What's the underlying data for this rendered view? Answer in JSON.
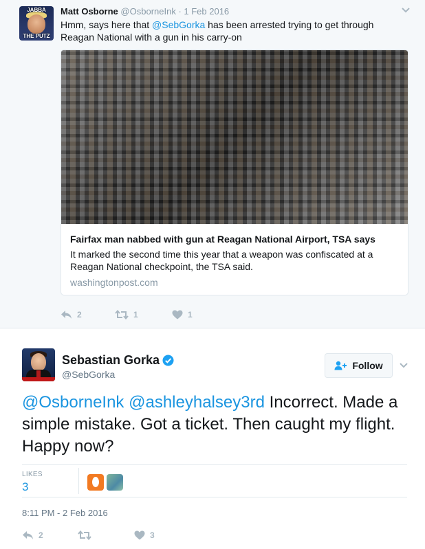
{
  "context_tweet": {
    "avatar_caption_top": "JABBA",
    "avatar_caption_bottom": "THE PUTZ",
    "name": "Matt Osborne",
    "handle": "@OsborneInk",
    "separator": " · ",
    "date": "1 Feb 2016",
    "text_before": "Hmm, says here that ",
    "mention": "@SebGorka",
    "text_after": " has been arrested trying to get through Reagan National with a gun in his carry-on",
    "card": {
      "title": "Fairfax man nabbed with gun at Reagan National Airport, TSA says",
      "description": "It marked the second time this year that a weapon was confiscated at a Reagan National checkpoint, the TSA said.",
      "domain": "washingtonpost.com"
    },
    "actions": {
      "reply_count": "2",
      "retweet_count": "1",
      "like_count": "1"
    }
  },
  "main_tweet": {
    "name": "Sebastian Gorka",
    "handle": "@SebGorka",
    "follow_label": "Follow",
    "mention1": "@OsborneInk",
    "mention2": "@ashleyhalsey3rd",
    "text": " Incorrect. Made a simple mistake. Got a ticket. Then caught my flight. Happy now?",
    "likes_label": "LIKES",
    "likes_count": "3",
    "timestamp": "8:11 PM - 2 Feb 2016",
    "actions": {
      "reply_count": "2",
      "retweet_count": "",
      "like_count": "3"
    }
  },
  "colors": {
    "link": "#1b95e0",
    "muted": "#8899a6",
    "icon": "#aab8c2",
    "context_bg": "#f5f8fa",
    "verified": "#1da1f2"
  },
  "icons": [
    "chevron-down-icon",
    "reply-icon",
    "retweet-icon",
    "heart-icon",
    "verified-icon",
    "follow-person-icon"
  ]
}
